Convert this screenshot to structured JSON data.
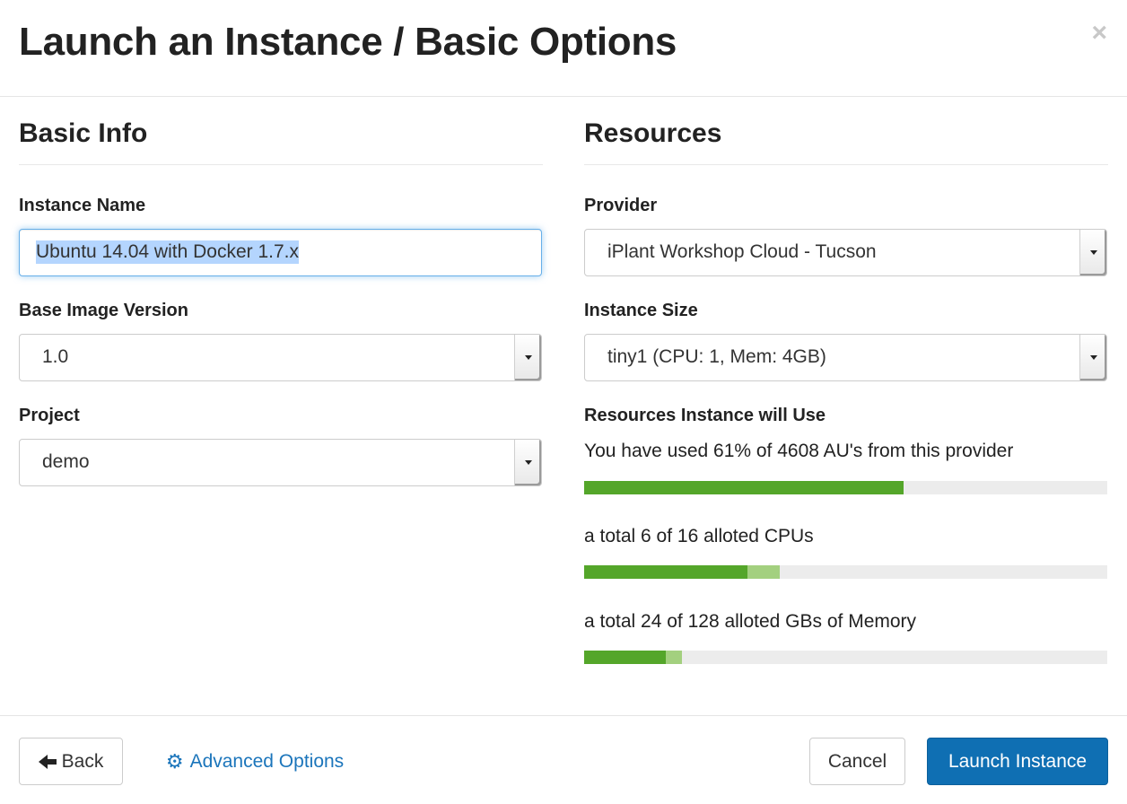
{
  "header": {
    "title": "Launch an Instance / Basic Options",
    "close_glyph": "×"
  },
  "basic_info": {
    "title": "Basic Info",
    "instance_name_label": "Instance Name",
    "instance_name_value": "Ubuntu 14.04 with Docker 1.7.x",
    "base_image_label": "Base Image Version",
    "base_image_value": "1.0",
    "project_label": "Project",
    "project_value": "demo"
  },
  "resources": {
    "title": "Resources",
    "provider_label": "Provider",
    "provider_value": "iPlant Workshop Cloud - Tucson",
    "size_label": "Instance Size",
    "size_value": "tiny1 (CPU: 1, Mem: 4GB)",
    "usage_label": "Resources Instance will Use",
    "au_text": "You have used 61% of 4608 AU's from this provider",
    "au_used_fraction": 0.61,
    "cpu_text": "a total 6 of 16 alloted CPUs",
    "cpu_used": 5,
    "cpu_added": 1,
    "cpu_total": 16,
    "mem_text": "a total 24 of 128 alloted GBs of Memory",
    "mem_used": 20,
    "mem_added": 4,
    "mem_total": 128,
    "bar_used_color": "#54a62a",
    "bar_added_color": "#a3d07f",
    "bar_track_color": "#ececec"
  },
  "footer": {
    "back_label": "Back",
    "advanced_label": "Advanced Options",
    "cancel_label": "Cancel",
    "launch_label": "Launch Instance"
  }
}
